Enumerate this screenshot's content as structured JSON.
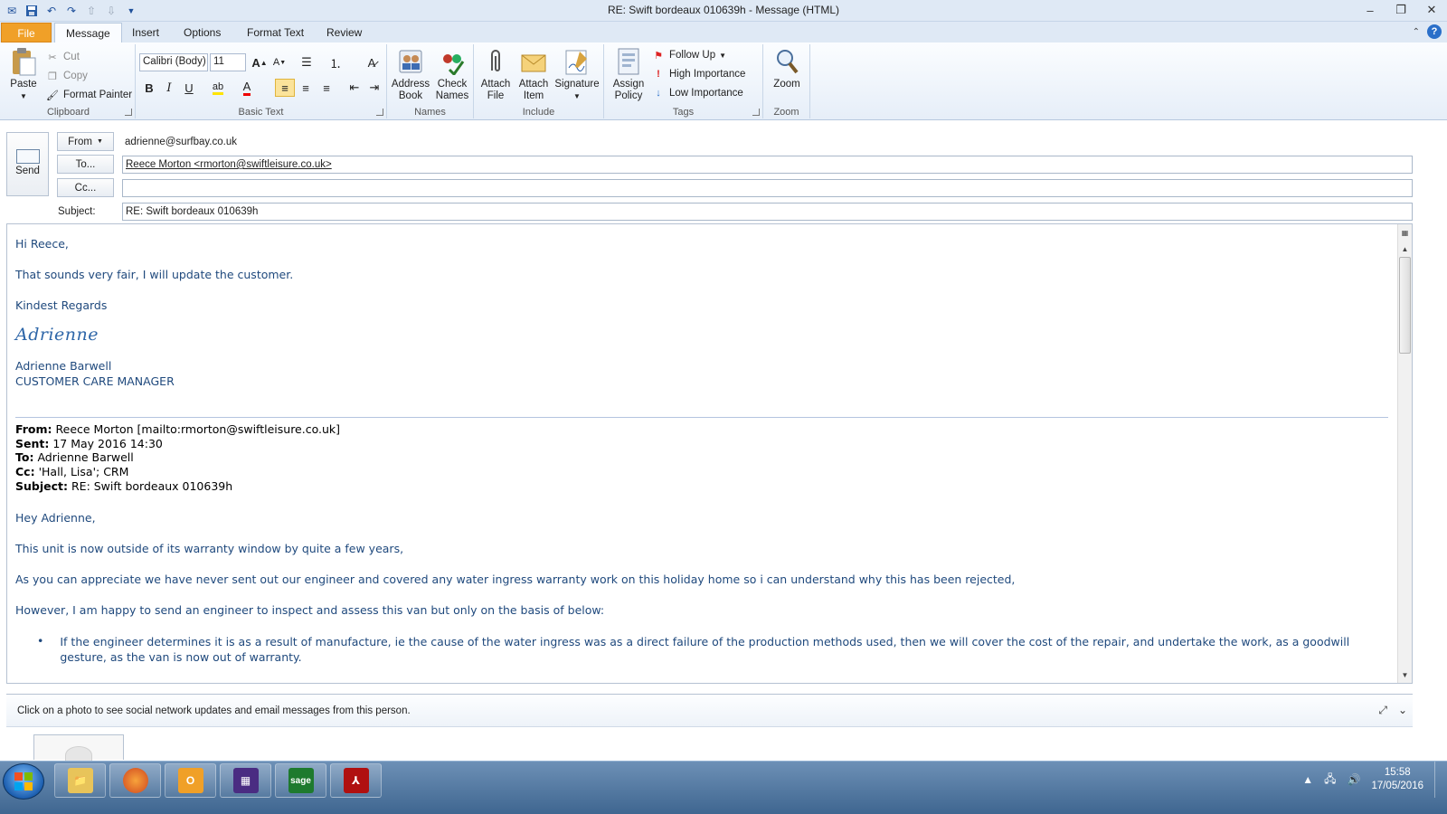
{
  "window": {
    "title": "RE: Swift  bordeaux 010639h  -  Message (HTML)"
  },
  "tabs": [
    "File",
    "Message",
    "Insert",
    "Options",
    "Format Text",
    "Review"
  ],
  "ribbon": {
    "clipboard": {
      "label": "Clipboard",
      "paste": "Paste",
      "cut": "Cut",
      "copy": "Copy",
      "format_painter": "Format Painter"
    },
    "basic_text": {
      "label": "Basic Text",
      "font": "Calibri (Body)",
      "size": "11",
      "bold": "B",
      "italic": "I",
      "underline": "U"
    },
    "names": {
      "label": "Names",
      "address_book": "Address Book",
      "check_names": "Check Names"
    },
    "include": {
      "label": "Include",
      "attach_file": "Attach File",
      "attach_item": "Attach Item",
      "signature": "Signature"
    },
    "tags": {
      "label": "Tags",
      "assign_policy": "Assign Policy",
      "follow_up": "Follow Up",
      "high_importance": "High Importance",
      "low_importance": "Low Importance"
    },
    "zoom": {
      "label": "Zoom",
      "zoom": "Zoom"
    }
  },
  "compose": {
    "send": "Send",
    "from_button": "From",
    "from_value": "adrienne@surfbay.co.uk",
    "to_button": "To...",
    "to_value": "Reece Morton <rmorton@swiftleisure.co.uk>",
    "cc_button": "Cc...",
    "cc_value": "",
    "subject_label": "Subject:",
    "subject_value": "RE: Swift  bordeaux 010639h"
  },
  "email_body": {
    "greeting": "Hi Reece,",
    "line1": "That sounds very fair, I will update the customer.",
    "closing": "Kindest Regards",
    "signature_script": "Adrienne",
    "signature_name": "Adrienne Barwell",
    "signature_title": "CUSTOMER CARE MANAGER",
    "quoted": {
      "from_label": "From:",
      "from_value": "Reece Morton [mailto:rmorton@swiftleisure.co.uk]",
      "sent_label": "Sent:",
      "sent_value": "17 May 2016 14:30",
      "to_label": "To:",
      "to_value": "Adrienne Barwell",
      "cc_label": "Cc:",
      "cc_value": "'Hall, Lisa'; CRM",
      "subject_label": "Subject:",
      "subject_value": "RE: Swift bordeaux 010639h"
    },
    "q_greeting": "Hey Adrienne,",
    "q_p1": "This unit is now outside of its warranty window by quite a few years,",
    "q_p2": "As you can appreciate we have never sent out our engineer and covered any water ingress warranty work on this holiday home so i can understand why this has been rejected,",
    "q_p3": "However, I am happy to send an engineer to inspect and assess this van but only on the basis of below:",
    "q_bullet1": "If the engineer determines it is as a result of manufacture, ie the cause of the water ingress was as a direct failure of the production methods used, then we will cover the cost of the repair, and undertake the work, as a goodwill gesture, as the van is now out of warranty."
  },
  "people_pane": {
    "message": "Click on a photo to see social network updates and email messages from this person."
  },
  "taskbar": {
    "items": [
      "explorer",
      "firefox",
      "outlook",
      "app",
      "sage",
      "acrobat"
    ],
    "sage_label": "sage",
    "time": "15:58",
    "date": "17/05/2016"
  },
  "colors": {
    "body_text": "#1f497d",
    "file_tab": "#f0a028",
    "accent": "#2a6fc9"
  }
}
